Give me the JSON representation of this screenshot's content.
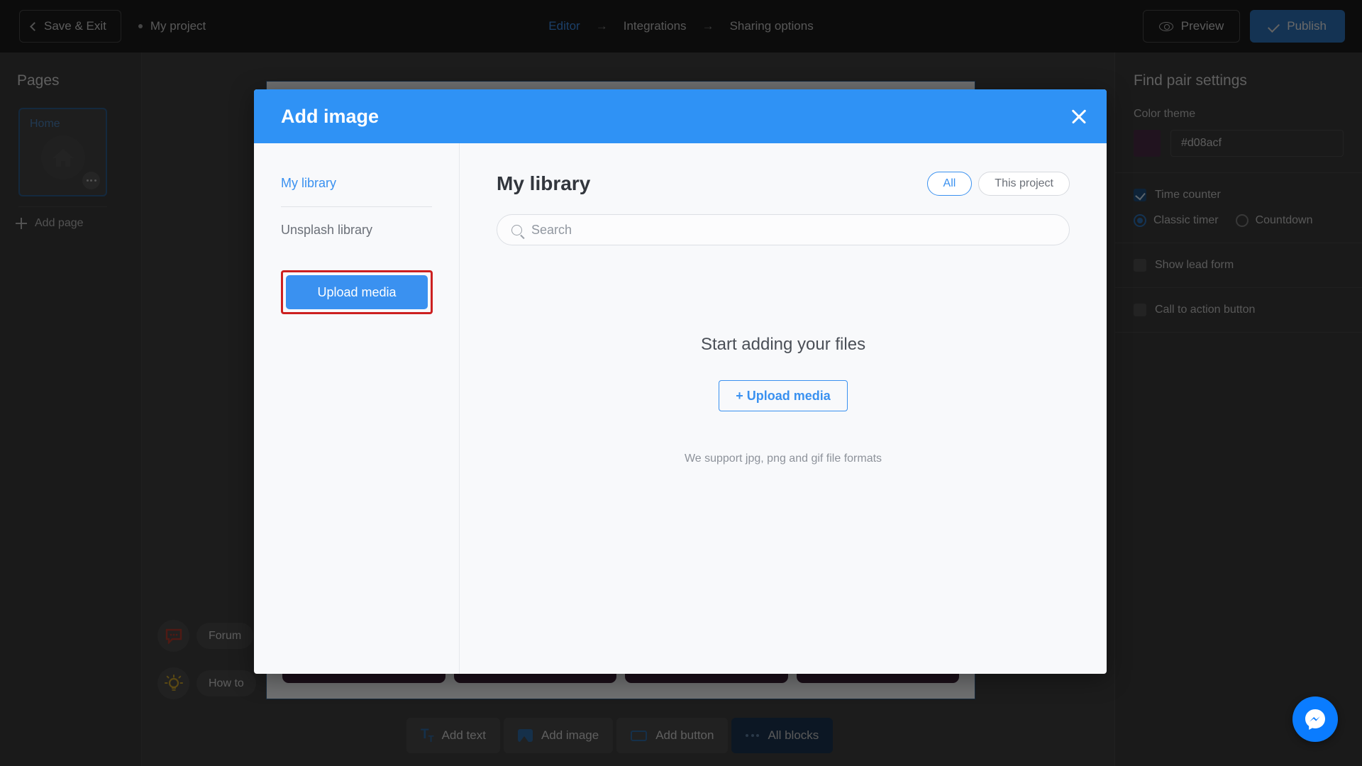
{
  "topbar": {
    "save_exit": "Save & Exit",
    "project_name": "My project",
    "nav": [
      {
        "label": "Editor",
        "active": true
      },
      {
        "label": "Integrations",
        "active": false
      },
      {
        "label": "Sharing options",
        "active": false
      }
    ],
    "arrow": "→",
    "preview": "Preview",
    "publish": "Publish"
  },
  "pages": {
    "title": "Pages",
    "home_label": "Home",
    "add_page": "Add page"
  },
  "help": {
    "forum": "Forum",
    "how_to": "How to"
  },
  "toolbar": {
    "add_text": "Add text",
    "add_image": "Add image",
    "add_button": "Add button",
    "all_blocks": "All blocks"
  },
  "settings": {
    "title": "Find pair settings",
    "color_theme_label": "Color theme",
    "color_value": "#d08acf",
    "swatch_color": "#4a2a46",
    "time_counter": "Time counter",
    "classic_timer": "Classic timer",
    "countdown": "Countdown",
    "show_lead_form": "Show lead form",
    "call_to_action": "Call to action button"
  },
  "modal": {
    "title": "Add image",
    "sidebar": {
      "my_library": "My library",
      "unsplash_library": "Unsplash library",
      "upload_media": "Upload media"
    },
    "main": {
      "heading": "My library",
      "toggle_all": "All",
      "toggle_this_project": "This project",
      "search_placeholder": "Search",
      "empty_title": "Start adding your files",
      "empty_upload": "+ Upload media",
      "empty_note": "We support jpg, png and gif file formats"
    }
  },
  "colors": {
    "modal_header": "#2f92f5",
    "accent_blue": "#3a91f0",
    "highlight_red": "#cc2020",
    "publish_blue": "#2e72b8"
  }
}
